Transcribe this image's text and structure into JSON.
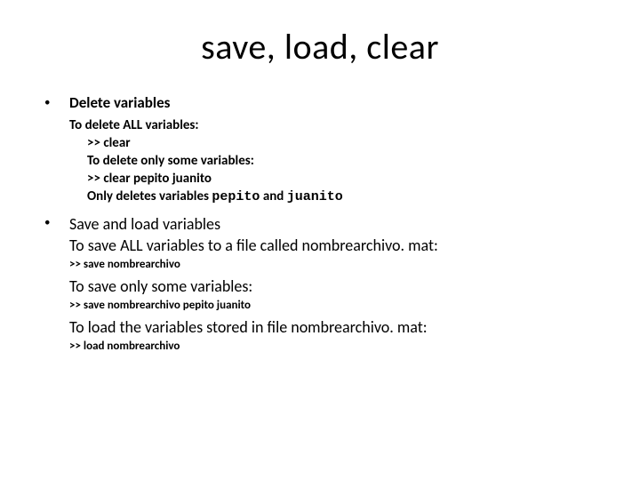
{
  "title": "save, load, clear",
  "section1": {
    "heading": "Delete variables",
    "line_all": "To delete ALL variables:",
    "cmd_all": ">> clear",
    "line_some": "To delete only some variables:",
    "cmd_some": ">> clear pepito juanito",
    "note_prefix": "Only deletes variables ",
    "note_var1": "pepito",
    "note_mid": " and ",
    "note_var2": "juanito"
  },
  "section2": {
    "heading": "Save and load variables",
    "line_save_all": "To save ALL variables to a file called nombrearchivo. mat:",
    "cmd_save_all": ">> save nombrearchivo",
    "line_save_some": "To save only some variables:",
    "cmd_save_some": ">> save nombrearchivo pepito juanito",
    "line_load": "To load the variables stored in file nombrearchivo. mat:",
    "cmd_load": ">> load nombrearchivo"
  }
}
